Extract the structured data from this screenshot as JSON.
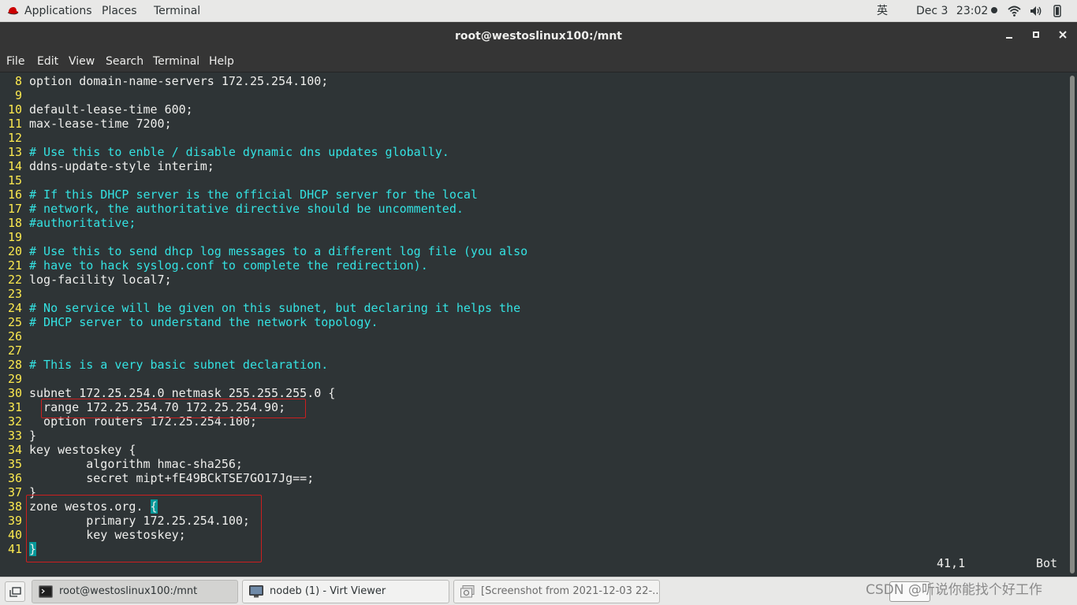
{
  "topbar": {
    "applications": "Applications",
    "places": "Places",
    "terminal": "Terminal",
    "input_method": "英",
    "date": "Dec 3",
    "time": "23:02",
    "icons": [
      "redhat-icon",
      "wifi-icon",
      "volume-icon",
      "power-icon"
    ]
  },
  "window": {
    "title": "root@westoslinux100:/mnt",
    "menus": [
      "File",
      "Edit",
      "View",
      "Search",
      "Terminal",
      "Help"
    ]
  },
  "editor": {
    "lines": [
      {
        "n": "8",
        "t": "option domain-name-servers 172.25.254.100;",
        "c": false
      },
      {
        "n": "9",
        "t": "",
        "c": false
      },
      {
        "n": "10",
        "t": "default-lease-time 600;",
        "c": false
      },
      {
        "n": "11",
        "t": "max-lease-time 7200;",
        "c": false
      },
      {
        "n": "12",
        "t": "",
        "c": false
      },
      {
        "n": "13",
        "t": "# Use this to enble / disable dynamic dns updates globally.",
        "c": true
      },
      {
        "n": "14",
        "t": "ddns-update-style interim;",
        "c": false
      },
      {
        "n": "15",
        "t": "",
        "c": false
      },
      {
        "n": "16",
        "t": "# If this DHCP server is the official DHCP server for the local",
        "c": true
      },
      {
        "n": "17",
        "t": "# network, the authoritative directive should be uncommented.",
        "c": true
      },
      {
        "n": "18",
        "t": "#authoritative;",
        "c": true
      },
      {
        "n": "19",
        "t": "",
        "c": false
      },
      {
        "n": "20",
        "t": "# Use this to send dhcp log messages to a different log file (you also",
        "c": true
      },
      {
        "n": "21",
        "t": "# have to hack syslog.conf to complete the redirection).",
        "c": true
      },
      {
        "n": "22",
        "t": "log-facility local7;",
        "c": false
      },
      {
        "n": "23",
        "t": "",
        "c": false
      },
      {
        "n": "24",
        "t": "# No service will be given on this subnet, but declaring it helps the",
        "c": true
      },
      {
        "n": "25",
        "t": "# DHCP server to understand the network topology.",
        "c": true
      },
      {
        "n": "26",
        "t": "",
        "c": false
      },
      {
        "n": "27",
        "t": "",
        "c": false
      },
      {
        "n": "28",
        "t": "# This is a very basic subnet declaration.",
        "c": true
      },
      {
        "n": "29",
        "t": "",
        "c": false
      },
      {
        "n": "30",
        "t": "subnet 172.25.254.0 netmask 255.255.255.0 {",
        "c": false
      },
      {
        "n": "31",
        "t": "  range 172.25.254.70 172.25.254.90;",
        "c": false
      },
      {
        "n": "32",
        "t": "  option routers 172.25.254.100;",
        "c": false
      },
      {
        "n": "33",
        "t": "}",
        "c": false
      },
      {
        "n": "34",
        "t": "key westoskey {",
        "c": false
      },
      {
        "n": "35",
        "t": "        algorithm hmac-sha256;",
        "c": false
      },
      {
        "n": "36",
        "t": "        secret mipt+fE49BCkTSE7GO17Jg==;",
        "c": false
      },
      {
        "n": "37",
        "t": "}",
        "c": false
      },
      {
        "n": "38",
        "t": "zone westos.org. {",
        "c": false
      },
      {
        "n": "39",
        "t": "        primary 172.25.254.100;",
        "c": false
      },
      {
        "n": "40",
        "t": "        key westoskey;",
        "c": false
      },
      {
        "n": "41",
        "t": "}",
        "c": false
      }
    ],
    "status_position": "41,1",
    "status_scroll": "Bot"
  },
  "taskbar": {
    "items": [
      {
        "label": "root@westoslinux100:/mnt",
        "icon": "terminal-icon"
      },
      {
        "label": "nodeb (1) - Virt Viewer",
        "icon": "monitor-icon"
      },
      {
        "label": "[Screenshot from 2021-12-03 22-...",
        "icon": "image-viewer-icon"
      }
    ]
  },
  "watermark": "CSDN @听说你能找个好工作"
}
